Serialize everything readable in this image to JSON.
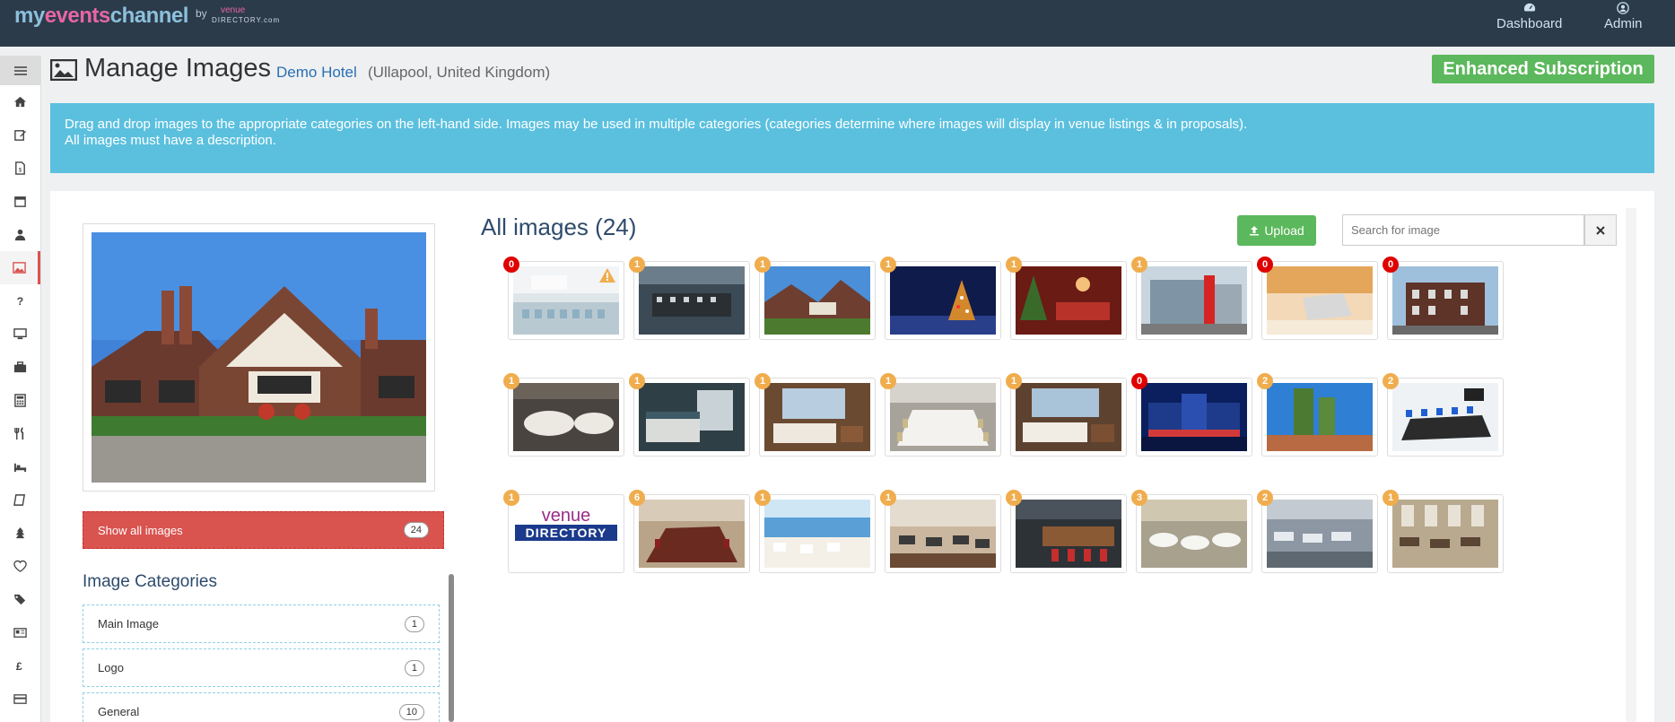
{
  "brand": {
    "name_a": "my",
    "name_b": "events",
    "name_c": "channel",
    "by": "by",
    "vd_top": "venue",
    "vd_bottom": "DIRECTORY.com"
  },
  "topnav": [
    {
      "label": "Dashboard",
      "icon": "dashboard-icon"
    },
    {
      "label": "Admin",
      "icon": "user-circle-icon"
    }
  ],
  "sidebar": {
    "toggle_icon": "menu-icon",
    "items": [
      {
        "icon": "home-icon"
      },
      {
        "icon": "edit-icon"
      },
      {
        "icon": "file-icon"
      },
      {
        "icon": "calendar-icon"
      },
      {
        "icon": "user-icon"
      },
      {
        "icon": "image-icon",
        "active": true
      },
      {
        "icon": "question-icon"
      },
      {
        "icon": "monitor-icon"
      },
      {
        "icon": "briefcase-icon"
      },
      {
        "icon": "calculator-icon"
      },
      {
        "icon": "cutlery-icon"
      },
      {
        "icon": "bed-icon"
      },
      {
        "icon": "book-icon"
      },
      {
        "icon": "tree-icon"
      },
      {
        "icon": "heart-icon"
      },
      {
        "icon": "tags-icon"
      },
      {
        "icon": "newspaper-icon"
      },
      {
        "icon": "pound-icon"
      },
      {
        "icon": "credit-card-icon"
      }
    ]
  },
  "header": {
    "title": "Manage Images",
    "venue_name": "Demo Hotel",
    "venue_location": "(Ullapool, United Kingdom)",
    "subscription": "Enhanced Subscription"
  },
  "info": {
    "line1": "Drag and drop images to the appropriate categories on the left-hand side. Images may be used in multiple categories (categories determine where images will display in venue listings & in proposals).",
    "line2": "All images must have a description."
  },
  "left": {
    "show_all_label": "Show all images",
    "show_all_count": "24",
    "categories_title": "Image Categories",
    "categories": [
      {
        "label": "Main Image",
        "count": "1"
      },
      {
        "label": "Logo",
        "count": "1"
      },
      {
        "label": "General",
        "count": "10"
      }
    ]
  },
  "gallery": {
    "title": "All images (24)",
    "upload_label": "Upload",
    "search_placeholder": "Search for image",
    "badge_colors": {
      "zero": "#e00000",
      "nonzero": "#f0ad4e"
    },
    "thumbs": [
      {
        "count": "0",
        "warning": true,
        "scene": "conference room"
      },
      {
        "count": "1",
        "scene": "boardroom table"
      },
      {
        "count": "1",
        "scene": "tudor building"
      },
      {
        "count": "1",
        "scene": "christmas tree night"
      },
      {
        "count": "1",
        "scene": "christmas dining"
      },
      {
        "count": "1",
        "scene": "modern building red"
      },
      {
        "count": "0",
        "scene": "laptop desk"
      },
      {
        "count": "0",
        "scene": "brick mansion"
      },
      {
        "count": "1",
        "scene": "round table banquet"
      },
      {
        "count": "1",
        "scene": "hotel bedroom"
      },
      {
        "count": "1",
        "scene": "bedroom window view"
      },
      {
        "count": "1",
        "scene": "long dining table"
      },
      {
        "count": "1",
        "scene": "bedroom city view"
      },
      {
        "count": "0",
        "scene": "hotel night exterior"
      },
      {
        "count": "2",
        "scene": "green towers"
      },
      {
        "count": "2",
        "scene": "meeting room blue chairs"
      },
      {
        "count": "1",
        "scene": "venue directory logo"
      },
      {
        "count": "6",
        "scene": "boardroom long table"
      },
      {
        "count": "1",
        "scene": "sea view terrace"
      },
      {
        "count": "1",
        "scene": "restaurant"
      },
      {
        "count": "1",
        "scene": "bar red stools"
      },
      {
        "count": "3",
        "scene": "banquet white chairs"
      },
      {
        "count": "2",
        "scene": "restaurant grey"
      },
      {
        "count": "1",
        "scene": "dining hall windows"
      }
    ]
  }
}
